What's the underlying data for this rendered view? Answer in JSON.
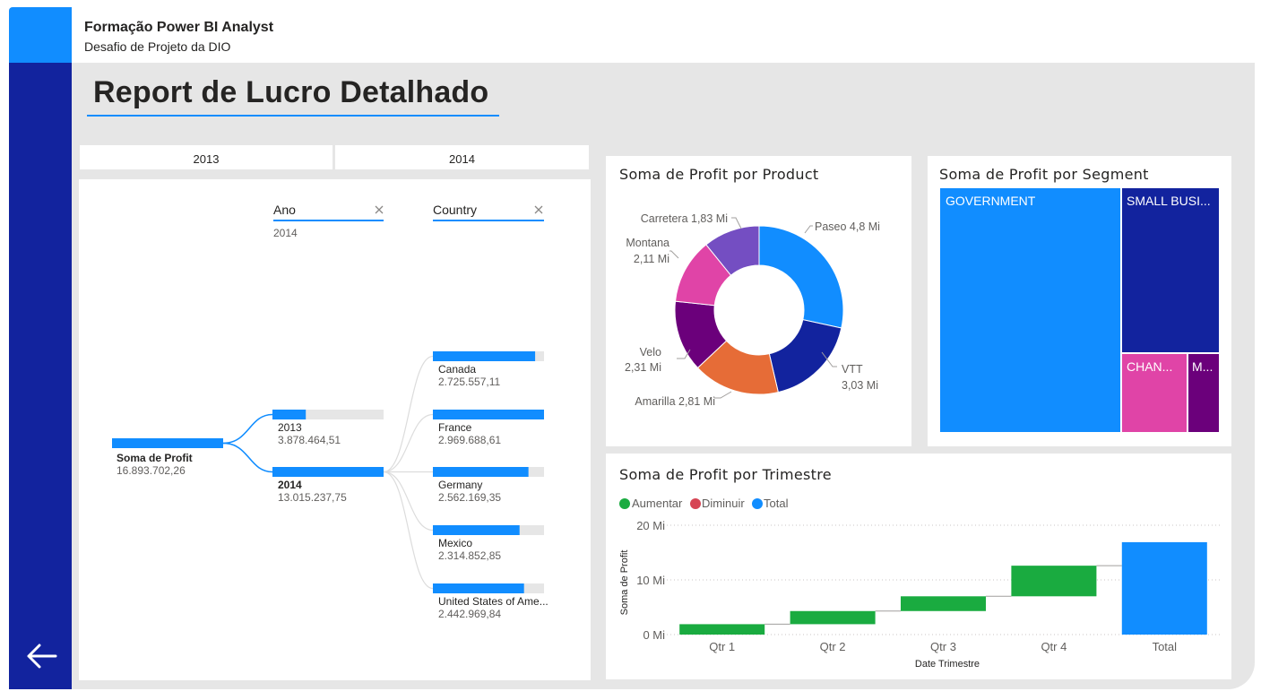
{
  "header": {
    "title": "Formação Power BI Analyst",
    "subtitle": "Desafio de Projeto da DIO"
  },
  "report": {
    "title": "Report de Lucro Detalhado"
  },
  "year_slicer": {
    "options": [
      "2013",
      "2014"
    ]
  },
  "decomposition_tree": {
    "levels": [
      {
        "header": "Ano",
        "selected": "2014"
      },
      {
        "header": "Country",
        "selected": ""
      }
    ],
    "root": {
      "label": "Soma de Profit",
      "value": "16.893.702,26"
    },
    "years": [
      {
        "label": "2013",
        "value": "3.878.464,51",
        "fraction": 0.3
      },
      {
        "label": "2014",
        "value": "13.015.237,75",
        "fraction": 1.0
      }
    ],
    "countries": [
      {
        "label": "Canada",
        "value": "2.725.557,11",
        "fraction": 0.92
      },
      {
        "label": "France",
        "value": "2.969.688,61",
        "fraction": 1.0
      },
      {
        "label": "Germany",
        "value": "2.562.169,35",
        "fraction": 0.86
      },
      {
        "label": "Mexico",
        "value": "2.314.852,85",
        "fraction": 0.78
      },
      {
        "label": "United States of Ame...",
        "value": "2.442.969,84",
        "fraction": 0.82
      }
    ]
  },
  "donut": {
    "title": "Soma de Profit por Product",
    "slices": [
      {
        "name": "Paseo",
        "value": 4.8,
        "label": "Paseo 4,8 Mi",
        "color": "#118dff"
      },
      {
        "name": "VTT",
        "value": 3.03,
        "label": "VTT 3,03 Mi",
        "color": "#12239e"
      },
      {
        "name": "Amarilla",
        "value": 2.81,
        "label": "Amarilla 2,81 Mi",
        "color": "#e66c37"
      },
      {
        "name": "Velo",
        "value": 2.31,
        "label": "Velo 2,31 Mi",
        "color": "#6b007b"
      },
      {
        "name": "Montana",
        "value": 2.11,
        "label": "Montana 2,11 Mi",
        "color": "#e044a7"
      },
      {
        "name": "Carretera",
        "value": 1.83,
        "label": "Carretera 1,83 Mi",
        "color": "#744ec2"
      }
    ],
    "label_text": {
      "paseo": "Paseo 4,8 Mi",
      "vtt_name": "VTT",
      "vtt_value": "3,03 Mi",
      "amarilla": "Amarilla 2,81 Mi",
      "velo_name": "Velo",
      "velo_value": "2,31 Mi",
      "montana_name": "Montana",
      "montana_value": "2,11 Mi",
      "carretera": "Carretera 1,83 Mi"
    }
  },
  "treemap": {
    "title": "Soma de Profit por Segment",
    "cells": [
      {
        "label": "GOVERNMENT",
        "color": "#118dff"
      },
      {
        "label": "SMALL BUSI...",
        "color": "#12239e"
      },
      {
        "label": "CHAN...",
        "color": "#e044a7"
      },
      {
        "label": "M...",
        "color": "#6b007b"
      }
    ]
  },
  "chart_data": {
    "type": "bar",
    "subtype": "waterfall",
    "title": "Soma de Profit por Trimestre",
    "xlabel": "Date Trimestre",
    "ylabel": "Soma de Profit",
    "categories": [
      "Qtr 1",
      "Qtr 2",
      "Qtr 3",
      "Qtr 4",
      "Total"
    ],
    "values": [
      1.9,
      2.4,
      2.7,
      5.6,
      16.9
    ],
    "ylim": [
      0,
      20
    ],
    "yticks": [
      "0 Mi",
      "10 Mi",
      "20 Mi"
    ],
    "legend": [
      "Aumentar",
      "Diminuir",
      "Total"
    ],
    "legend_colors": [
      "#1aab40",
      "#d64554",
      "#118dff"
    ],
    "legend_position": "top-left",
    "grid": true
  }
}
